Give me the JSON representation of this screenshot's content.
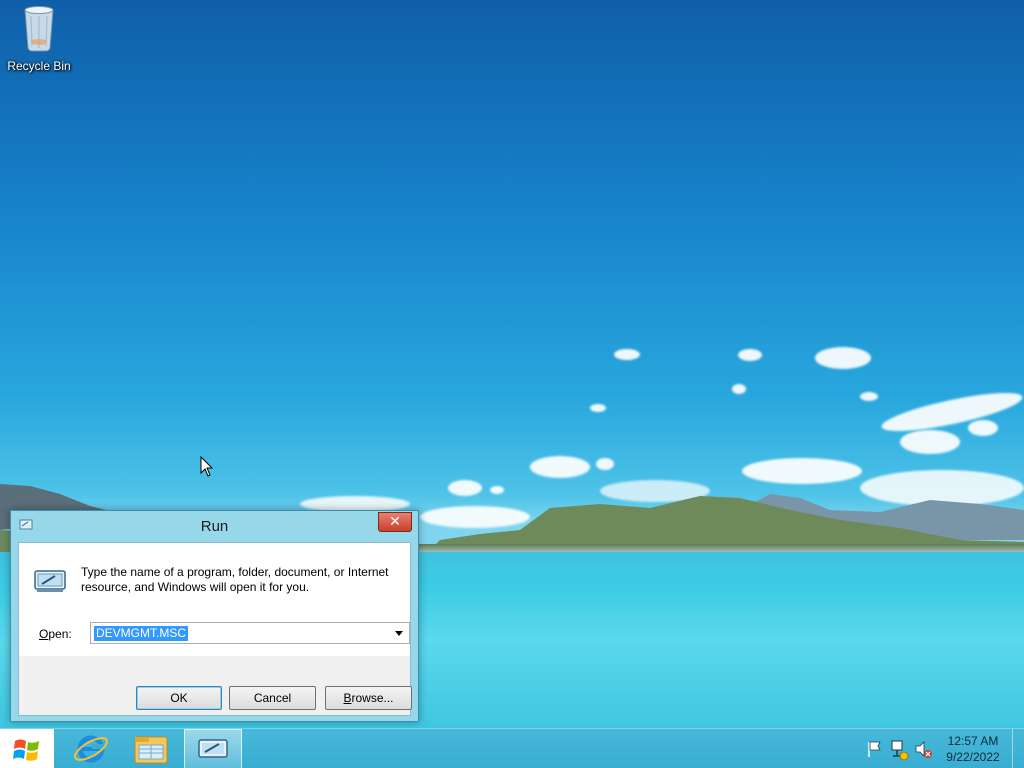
{
  "desktop": {
    "icons": [
      {
        "label": "Recycle Bin",
        "icon": "recycle-bin-icon"
      }
    ]
  },
  "run_dialog": {
    "title": "Run",
    "close_label": "✕",
    "description": "Type the name of a program, folder, document, or Internet resource, and Windows will open it for you.",
    "open_label_prefix": "O",
    "open_label_rest": "pen:",
    "open_value": "DEVMGMT.MSC",
    "buttons": {
      "ok": "OK",
      "cancel": "Cancel",
      "browse_prefix": "B",
      "browse_rest": "rowse..."
    }
  },
  "taskbar": {
    "start_icon": "windows-logo-icon",
    "apps": [
      {
        "name": "Internet Explorer",
        "icon": "internet-explorer-icon",
        "active": false
      },
      {
        "name": "File Explorer",
        "icon": "file-explorer-icon",
        "active": false
      },
      {
        "name": "Run",
        "icon": "run-icon",
        "active": true
      }
    ],
    "tray_icons": [
      "action-center-flag-icon",
      "network-icon",
      "volume-muted-icon"
    ],
    "clock": {
      "time": "12:57 AM",
      "date": "9/22/2022"
    }
  },
  "colors": {
    "close_button": "#c7402b",
    "selection": "#3399ff",
    "taskbar": "#39aed2",
    "window_frame": "#97d7ea"
  }
}
